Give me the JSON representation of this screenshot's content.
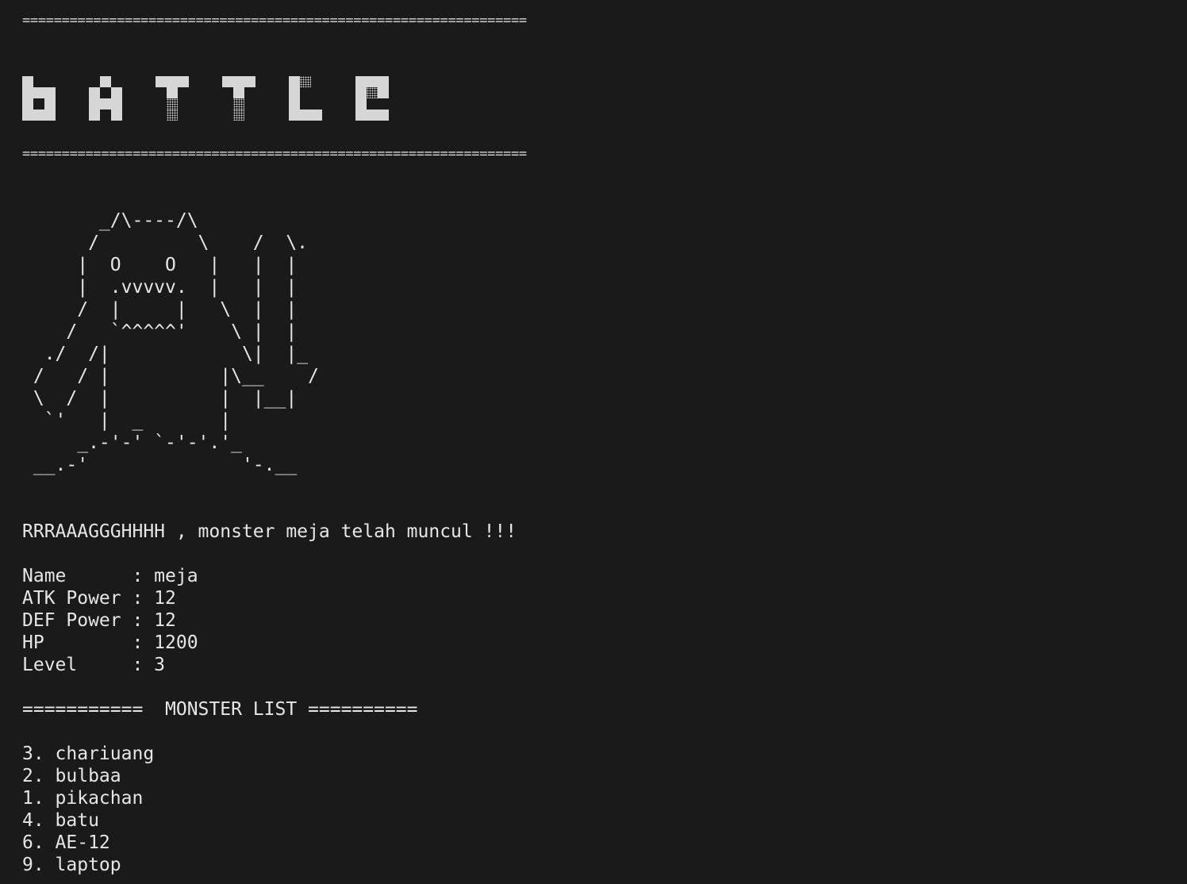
{
  "rule_top": "================================================================",
  "banner": {
    "word": "bATTLE",
    "letters": [
      "b",
      "A",
      "T",
      "T",
      "L",
      "E"
    ]
  },
  "rule_bottom": "================================================================",
  "monster_art": [
    "       _/\\----/\\",
    "      /         \\    /  \\.",
    "     |  O    O   |   |  |",
    "     |  .vvvvv.  |   |  |",
    "     /  |     |   \\  |  |",
    "    /   `^^^^^'    \\ |  |",
    "  ./  /|            \\|  |_",
    " /   / |          |\\__    /",
    " \\  /  |          |  |__|",
    "  `'   |  _       |",
    "     _.-'-' `-'-'.'_",
    " __.-'              '-.__"
  ],
  "announcement": "RRRAAAGGGHHHH , monster meja telah muncul !!!",
  "stats": [
    {
      "label": "Name     ",
      "value": "meja"
    },
    {
      "label": "ATK Power",
      "value": "12"
    },
    {
      "label": "DEF Power",
      "value": "12"
    },
    {
      "label": "HP       ",
      "value": "1200"
    },
    {
      "label": "Level    ",
      "value": "3"
    }
  ],
  "monster_list_header": "===========  MONSTER LIST ==========",
  "monster_list": [
    "3. chariuang",
    "2. bulbaa",
    "1. pikachan",
    "4. batu",
    "6. AE-12",
    "9. laptop"
  ],
  "colors": {
    "background": "#1a1a1a",
    "text": "#e6e6e6"
  }
}
